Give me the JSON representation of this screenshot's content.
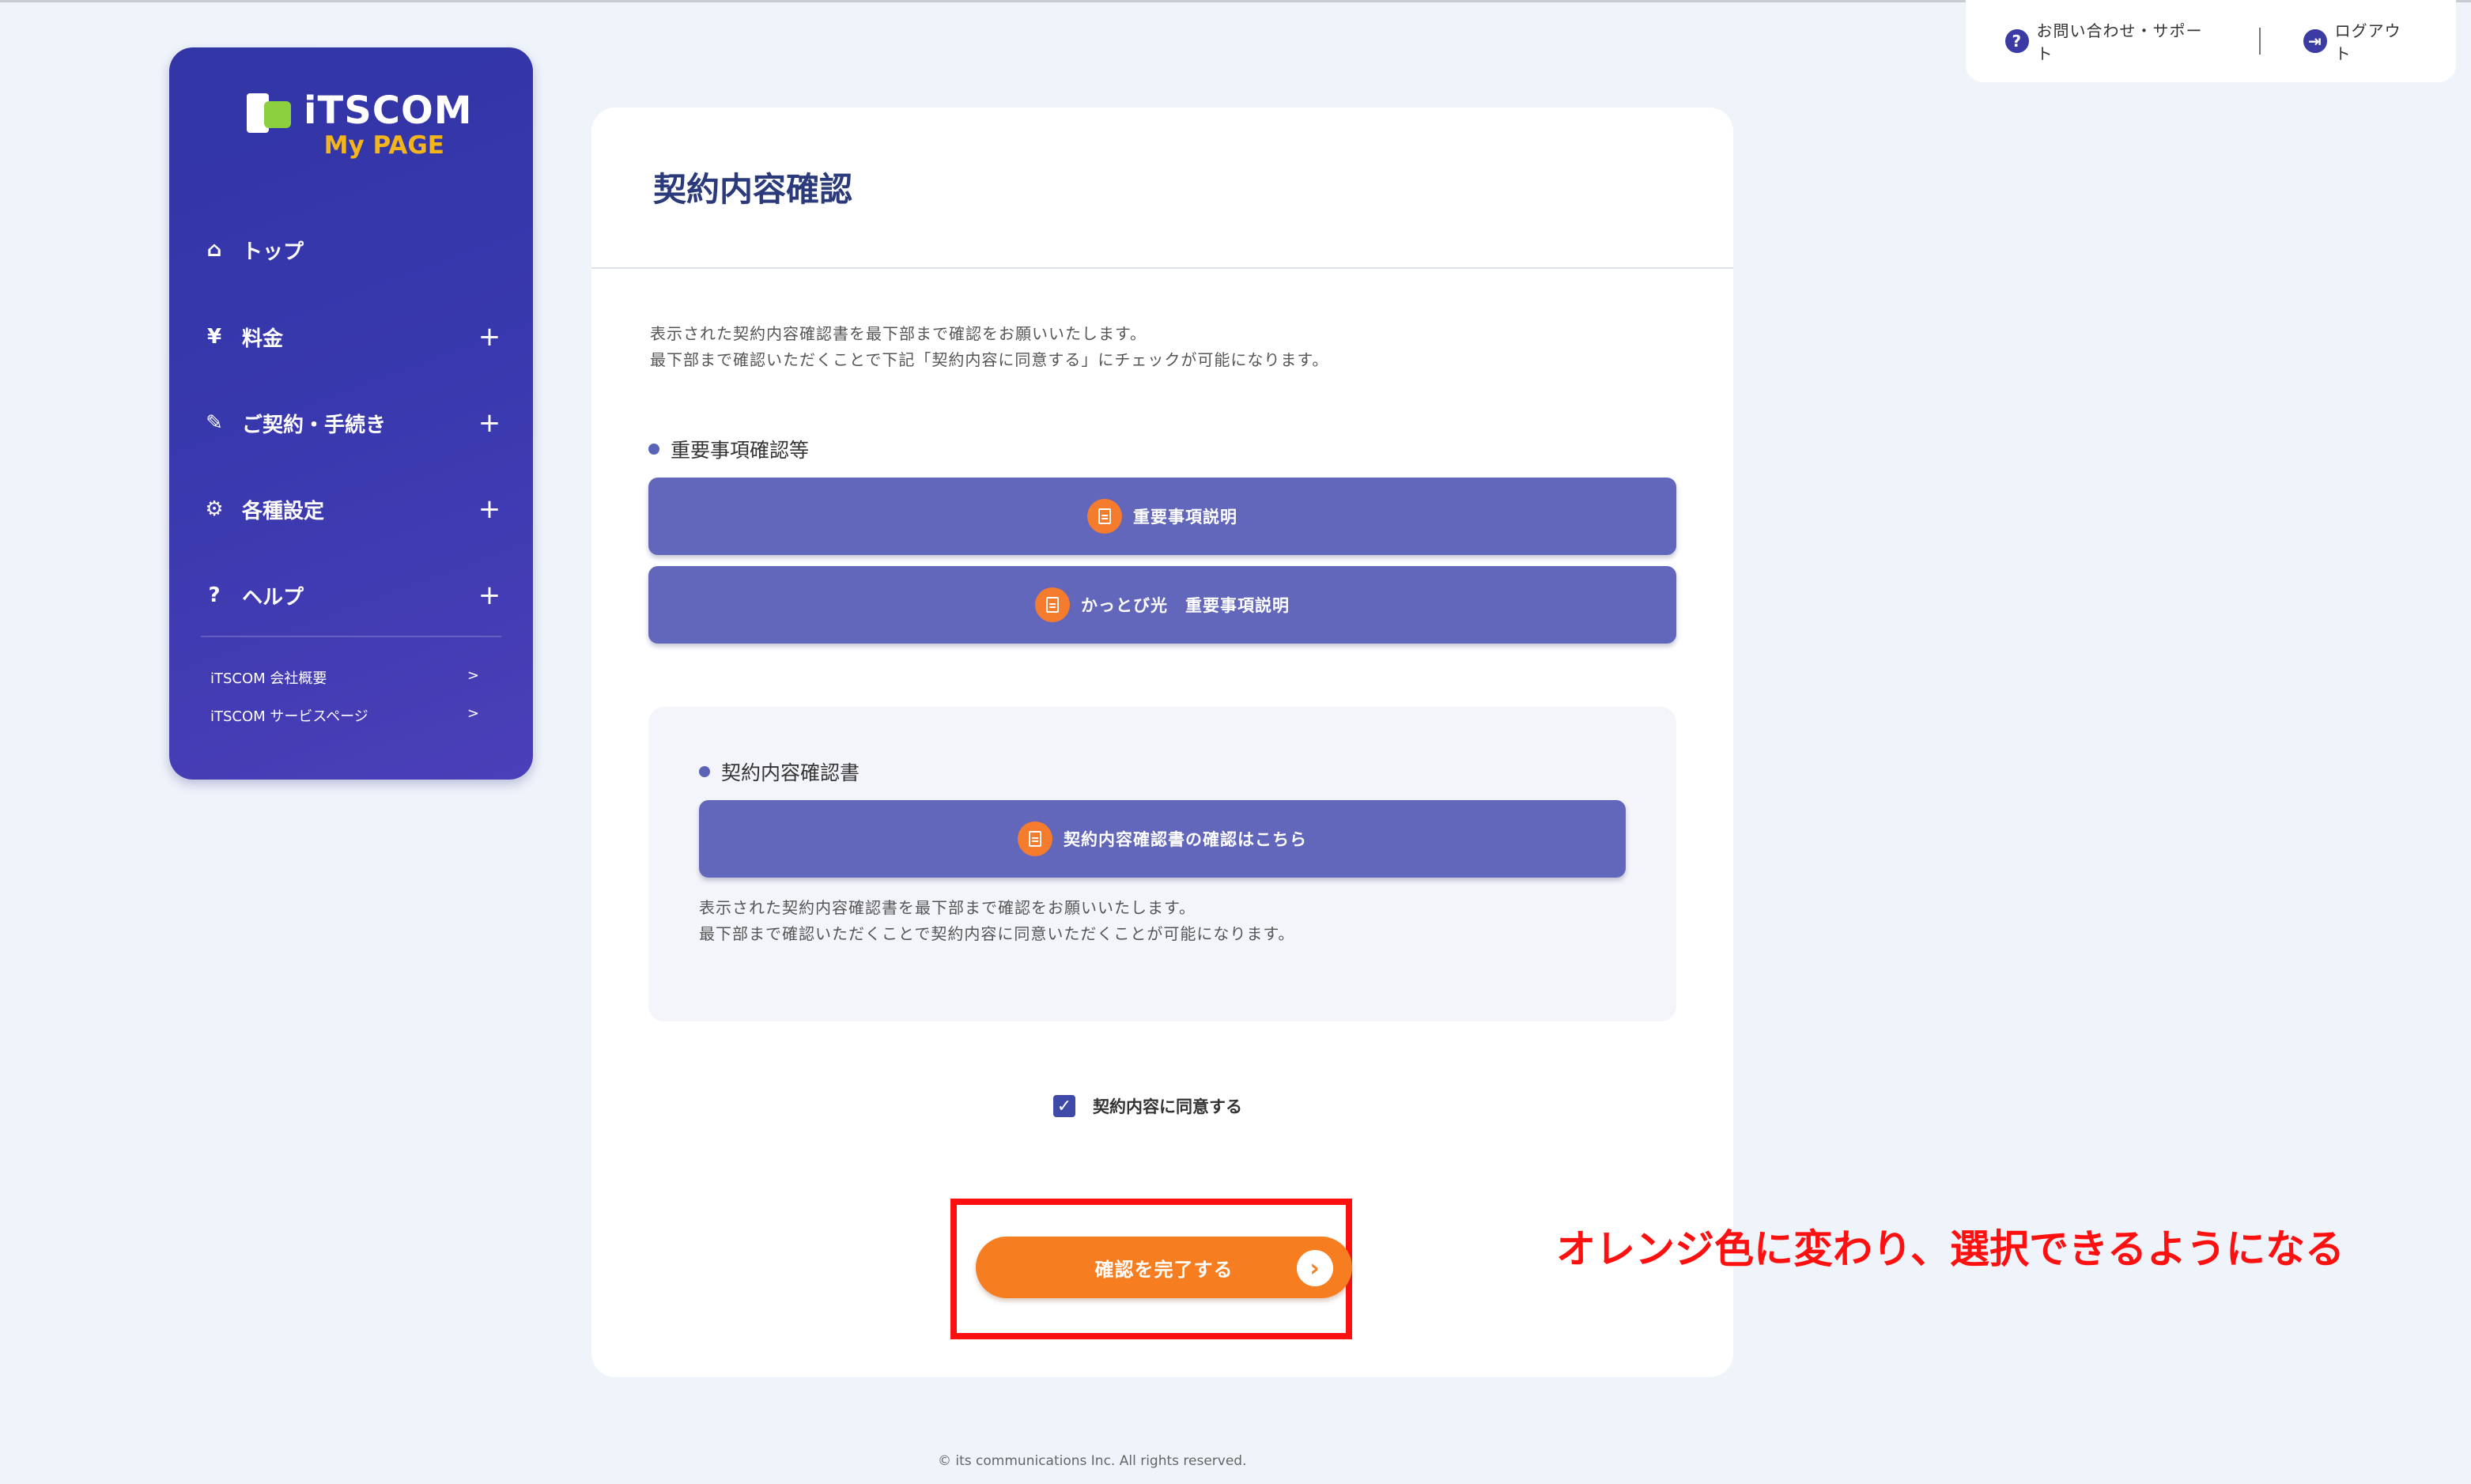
{
  "header": {
    "support_icon": "question-icon",
    "support_label": "お問い合わせ・サポート",
    "logout_icon": "logout-icon",
    "logout_label": "ログアウト"
  },
  "sidebar": {
    "logo_title": "iTSCOM",
    "logo_sub": "My PAGE",
    "items": [
      {
        "icon": "home-icon",
        "label": "トップ",
        "expandable": false
      },
      {
        "icon": "yen-icon",
        "label": "料金",
        "expandable": true
      },
      {
        "icon": "pen-icon",
        "label": "ご契約・手続き",
        "expandable": true
      },
      {
        "icon": "gear-icon",
        "label": "各種設定",
        "expandable": true
      },
      {
        "icon": "help-icon",
        "label": "ヘルプ",
        "expandable": true
      }
    ],
    "links": [
      {
        "label": "iTSCOM 会社概要",
        "arrow": ">"
      },
      {
        "label": "iTSCOM サービスページ",
        "arrow": ">"
      }
    ]
  },
  "main": {
    "title": "契約内容確認",
    "intro_line1": "表示された契約内容確認書を最下部まで確認をお願いいたします。",
    "intro_line2": "最下部まで確認いただくことで下記「契約内容に同意する」にチェックが可能になります。",
    "section1_label": "重要事項確認等",
    "doc_buttons": [
      {
        "label": "重要事項説明",
        "icon": "document-icon"
      },
      {
        "label": "かっとび光　重要事項説明",
        "icon": "document-icon"
      }
    ],
    "section2_label": "契約内容確認書",
    "confirm_doc_button": "契約内容確認書の確認はこちら",
    "panel_note_line1": "表示された契約内容確認書を最下部まで確認をお願いいたします。",
    "panel_note_line2": "最下部まで確認いただくことで契約内容に同意いただくことが可能になります。",
    "agree_label": "契約内容に同意する",
    "agree_checked": true,
    "complete_button": "確認を完了する"
  },
  "annotation": "オレンジ色に変わり、選択できるようになる",
  "footer": "© its communications Inc. All rights reserved.",
  "colors": {
    "sidebar": "#3838ad",
    "button": "#6267bb",
    "accent": "#f77e20",
    "annotation": "#ff1010"
  }
}
